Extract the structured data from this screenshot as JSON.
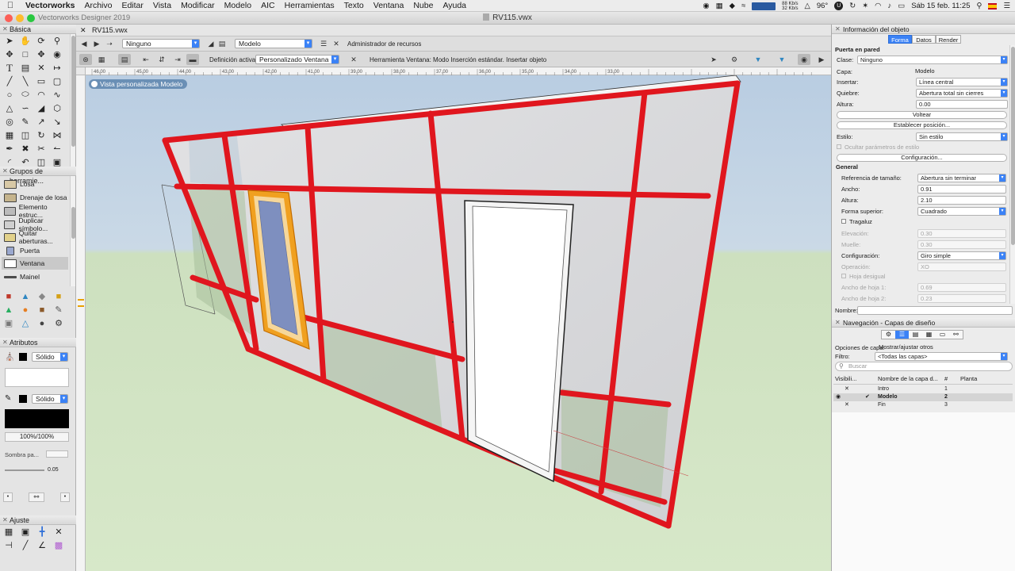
{
  "menubar": {
    "app": "Vectorworks",
    "items": [
      "Archivo",
      "Editar",
      "Vista",
      "Modificar",
      "Modelo",
      "AIC",
      "Herramientas",
      "Texto",
      "Ventana",
      "Nube",
      "Ayuda"
    ],
    "net_up": "88 Kb/s",
    "net_down": "32 Kb/s",
    "temp": "96°",
    "clock": "Sáb 15 feb.  11:25"
  },
  "window": {
    "app_title": "Vectorworks Designer 2019",
    "doc_title": "RV115.vwx",
    "tab": "RV115.vwx"
  },
  "toolbar": {
    "class_select": "Ninguno",
    "layer_select": "Modelo",
    "resource_manager": "Administrador de recursos",
    "active_def_label": "Definición activa:",
    "active_def_value": "Personalizado Ventana",
    "tool_status": "Herramienta Ventana: Modo Inserción estándar. Insertar objeto"
  },
  "ruler": {
    "marks": [
      "46,00",
      "45,00",
      "44,00",
      "43,00",
      "42,00",
      "41,00",
      "39,00",
      "38,00",
      "37,00",
      "36,00",
      "35,00",
      "34,00",
      "33,00"
    ]
  },
  "view": {
    "badge": "Vista personalizada  Modelo"
  },
  "left": {
    "basic_title": "Básica",
    "groups_title": "Grupos de herramie...",
    "tool_list": [
      {
        "label": "Losa"
      },
      {
        "label": "Drenaje de losa"
      },
      {
        "label": "Elemento estruc..."
      },
      {
        "label": "Duplicar símbolo..."
      },
      {
        "label": "Quitar aberturas..."
      },
      {
        "label": "Puerta"
      },
      {
        "label": "Ventana"
      },
      {
        "label": "Mainel"
      }
    ],
    "attributes_title": "Atributos",
    "fill_style": "Sólido",
    "pen_style": "Sólido",
    "opacity": "100%/100%",
    "shadow_label": "Sombra pa...",
    "line_weight": "0.05",
    "snap_title": "Ajuste"
  },
  "oip": {
    "title": "Información del objeto",
    "tabs": [
      "Forma",
      "Datos",
      "Render"
    ],
    "object_type": "Puerta en pared",
    "clase_label": "Clase:",
    "clase_value": "Ninguno",
    "capa_label": "Capa:",
    "capa_value": "Modelo",
    "insertar_label": "Insertar:",
    "insertar_value": "Línea central",
    "quiebre_label": "Quiebre:",
    "quiebre_value": "Abertura total sin cierres",
    "altura_label": "Altura:",
    "altura_value": "0.00",
    "voltear": "Voltear",
    "establecer": "Establecer posición...",
    "estilo_label": "Estilo:",
    "estilo_value": "Sin estilo",
    "ocultar": "Ocultar parámetros de estilo",
    "configuracion_btn": "Configuración...",
    "general_title": "General",
    "ref_label": "Referencia de tamaño:",
    "ref_value": "Abertura sin terminar",
    "ancho_label": "Ancho:",
    "ancho_value": "0.91",
    "alto_label": "Altura:",
    "alto_value": "2.10",
    "forma_label": "Forma superior:",
    "forma_value": "Cuadrado",
    "tragaluz": "Tragaluz",
    "elevacion_label": "Elevación:",
    "elevacion_value": "0.30",
    "muelle_label": "Muelle:",
    "muelle_value": "0.30",
    "config_label": "Configuración:",
    "config_value": "Giro simple",
    "operacion_label": "Operación:",
    "operacion_value": "XO",
    "hoja_desigual": "Hoja desigual",
    "hoja1_label": "Ancho de hoja 1:",
    "hoja1_value": "0.69",
    "hoja2_label": "Ancho de hoja 2:",
    "hoja2_value": "0.23",
    "nombre_label": "Nombre:"
  },
  "nav": {
    "title": "Navegación - Capas de diseño",
    "options_label": "Opciones de capa:",
    "options_value": "Mostrar/ajustar otros",
    "filter_label": "Filtro:",
    "filter_value": "<Todas las capas>",
    "search_placeholder": "Buscar",
    "columns": [
      "Visibili...",
      "Nombre de la capa d...",
      "#",
      "Planta"
    ],
    "layers": [
      {
        "name": "Intro",
        "num": "1"
      },
      {
        "name": "Modelo",
        "num": "2"
      },
      {
        "name": "Fin",
        "num": "3"
      }
    ]
  },
  "colors": {
    "accent": "#3b82f6",
    "frame_red": "#e0161e",
    "window_orange": "#f0a020",
    "glass_blue": "#7e8fbf"
  }
}
